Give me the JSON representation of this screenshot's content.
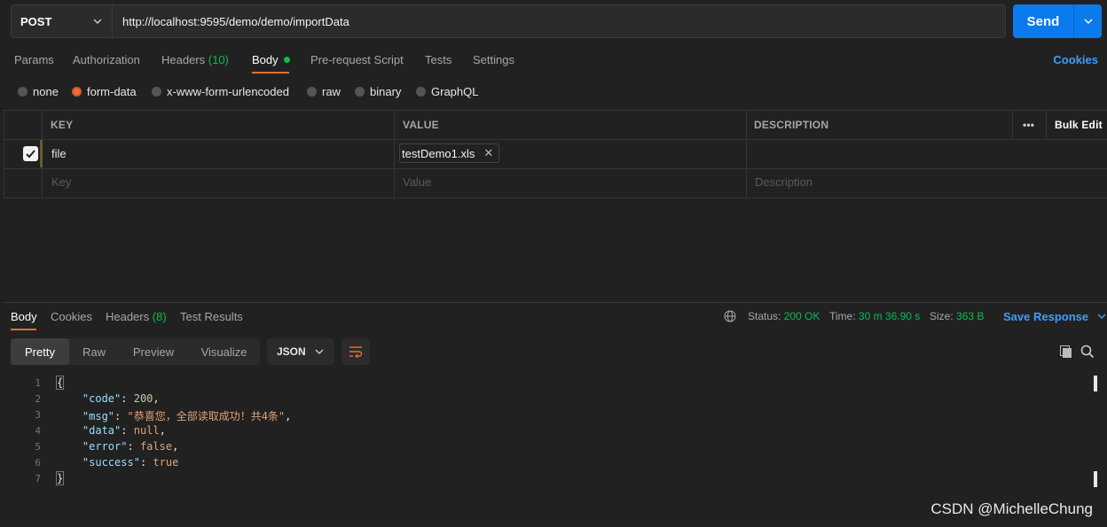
{
  "request": {
    "method": "POST",
    "url": "http://localhost:9595/demo/demo/importData",
    "send_label": "Send"
  },
  "req_tabs": {
    "params": "Params",
    "authorization": "Authorization",
    "headers": "Headers",
    "headers_count": "(10)",
    "body": "Body",
    "prerequest": "Pre-request Script",
    "tests": "Tests",
    "settings": "Settings",
    "cookies": "Cookies"
  },
  "body_types": {
    "none": "none",
    "form_data": "form-data",
    "urlencoded": "x-www-form-urlencoded",
    "raw": "raw",
    "binary": "binary",
    "graphql": "GraphQL",
    "selected": "form-data"
  },
  "table": {
    "col_key": "KEY",
    "col_value": "VALUE",
    "col_desc": "DESCRIPTION",
    "more": "•••",
    "bulk_edit": "Bulk Edit",
    "row": {
      "key": "file",
      "value": "testDemo1.xls",
      "checked": true
    },
    "placeholders": {
      "key": "Key",
      "value": "Value",
      "description": "Description"
    }
  },
  "response": {
    "tabs": {
      "body": "Body",
      "cookies": "Cookies",
      "headers": "Headers",
      "headers_count": "(8)",
      "test_results": "Test Results"
    },
    "status_label": "Status:",
    "status_value": "200 OK",
    "time_label": "Time:",
    "time_value": "30 m 36.90 s",
    "size_label": "Size:",
    "size_value": "363 B",
    "save_response": "Save Response",
    "views": {
      "pretty": "Pretty",
      "raw": "Raw",
      "preview": "Preview",
      "visualize": "Visualize"
    },
    "format": "JSON",
    "line_numbers": [
      "1",
      "2",
      "3",
      "4",
      "5",
      "6",
      "7"
    ],
    "json": {
      "open": "{",
      "code_key": "\"code\"",
      "code_val": "200",
      "msg_key": "\"msg\"",
      "msg_val": "\"恭喜您，全部读取成功！共4条\"",
      "data_key": "\"data\"",
      "data_val": "null",
      "error_key": "\"error\"",
      "error_val": "false",
      "success_key": "\"success\"",
      "success_val": "true",
      "close": "}"
    }
  },
  "watermark": "CSDN @MichelleChung",
  "colors": {
    "accent": "#f26b3a",
    "send": "#097bed",
    "ok": "#0cbb52",
    "link": "#3d9eff"
  }
}
